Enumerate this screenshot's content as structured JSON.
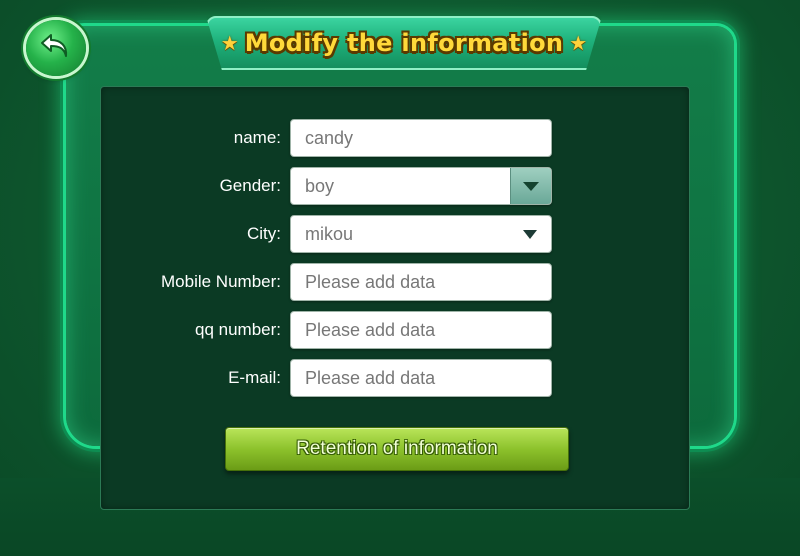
{
  "header": {
    "title": "Modify the information",
    "star_left": "★",
    "star_right": "★",
    "back_icon": "back-arrow-icon"
  },
  "form": {
    "name": {
      "label": "name:",
      "value": "candy"
    },
    "gender": {
      "label": "Gender:",
      "value": "boy"
    },
    "city": {
      "label": "City:",
      "value": "mikou"
    },
    "mobile": {
      "label": "Mobile Number:",
      "placeholder": "Please add data"
    },
    "qq": {
      "label": "qq number:",
      "placeholder": "Please add data"
    },
    "email": {
      "label": "E-mail:",
      "placeholder": "Please add data"
    }
  },
  "save_button": {
    "label": "Retention of information"
  },
  "colors": {
    "background": "#0f5a30",
    "frame_glow": "#1fd98a",
    "panel": "#0b3a24",
    "title_text": "#ffd93a",
    "save_button": "#8dc22c"
  }
}
